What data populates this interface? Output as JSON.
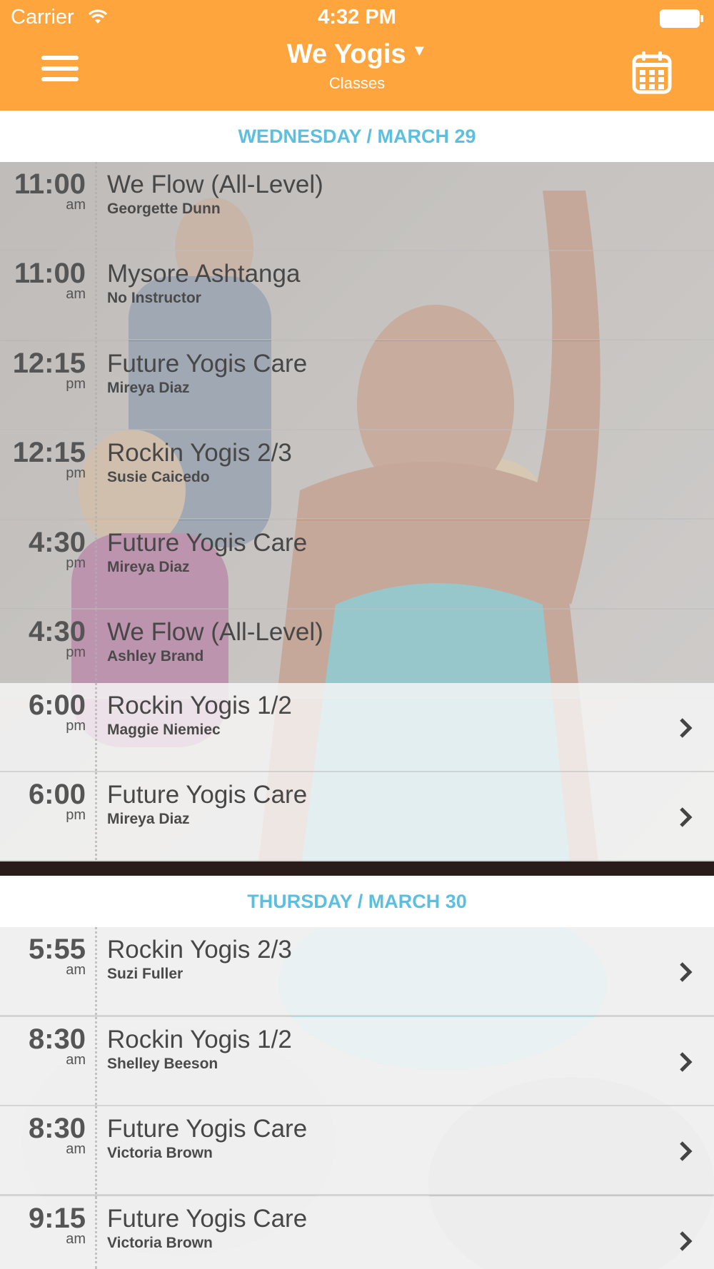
{
  "status_bar": {
    "carrier": "Carrier",
    "time": "4:32 PM"
  },
  "header": {
    "title": "We Yogis",
    "subtitle": "Classes",
    "menu_icon": "hamburger-menu-icon",
    "calendar_icon": "calendar-icon",
    "dropdown_icon": "triangle-down-icon"
  },
  "colors": {
    "accent": "#ffa53e",
    "day_header_text": "#5bbfe0",
    "text": "#474747"
  },
  "days": [
    {
      "label": "WEDNESDAY / MARCH 29",
      "classes": [
        {
          "time": "11:00",
          "ampm": "am",
          "name": "We Flow (All-Level)",
          "instructor": "Georgette Dunn"
        },
        {
          "time": "11:00",
          "ampm": "am",
          "name": "Mysore Ashtanga",
          "instructor": "No Instructor"
        },
        {
          "time": "12:15",
          "ampm": "pm",
          "name": "Future Yogis Care",
          "instructor": "Mireya Diaz"
        },
        {
          "time": "12:15",
          "ampm": "pm",
          "name": "Rockin Yogis 2/3",
          "instructor": "Susie Caicedo"
        },
        {
          "time": "4:30",
          "ampm": "pm",
          "name": "Future Yogis Care",
          "instructor": "Mireya Diaz"
        },
        {
          "time": "4:30",
          "ampm": "pm",
          "name": "We Flow (All-Level)",
          "instructor": "Ashley Brand"
        },
        {
          "time": "6:00",
          "ampm": "pm",
          "name": "Rockin Yogis 1/2",
          "instructor": "Maggie Niemiec"
        },
        {
          "time": "6:00",
          "ampm": "pm",
          "name": "Future Yogis Care",
          "instructor": "Mireya Diaz"
        }
      ]
    },
    {
      "label": "THURSDAY / MARCH 30",
      "classes": [
        {
          "time": "5:55",
          "ampm": "am",
          "name": "Rockin Yogis 2/3",
          "instructor": "Suzi Fuller"
        },
        {
          "time": "8:30",
          "ampm": "am",
          "name": "Rockin Yogis 1/2",
          "instructor": "Shelley Beeson"
        },
        {
          "time": "8:30",
          "ampm": "am",
          "name": "Future Yogis Care",
          "instructor": "Victoria Brown"
        },
        {
          "time": "9:15",
          "ampm": "am",
          "name": "Future Yogis Care",
          "instructor": "Victoria Brown"
        }
      ]
    }
  ]
}
